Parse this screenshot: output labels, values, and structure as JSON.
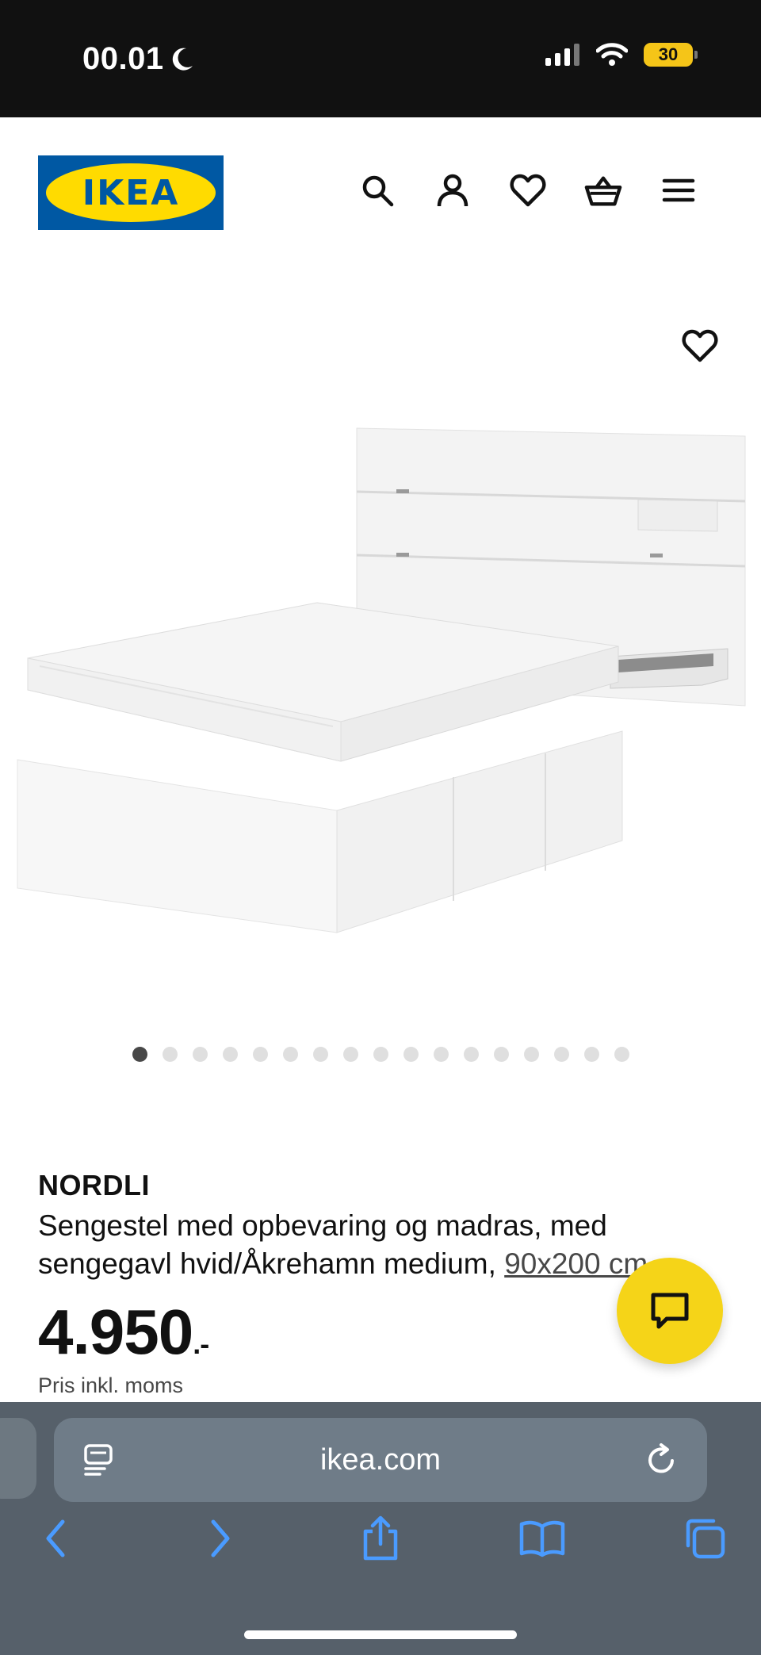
{
  "status_bar": {
    "time": "00.01",
    "battery": "30"
  },
  "header": {
    "logo_text": "IKEA",
    "icons": [
      "search-icon",
      "account-icon",
      "heart-icon",
      "basket-icon",
      "menu-icon"
    ]
  },
  "gallery": {
    "total_images": 17,
    "active_index": 0
  },
  "product": {
    "brand": "NORDLI",
    "description": "Sengestel med opbevaring og madras, med sengegavl hvid/Åkrehamn medium, ",
    "size": "90x200 cm",
    "price_main": "4.950",
    "price_suffix": ".-",
    "vat_note": "Pris inkl. moms"
  },
  "browser": {
    "url": "ikea.com"
  },
  "colors": {
    "ikea_blue": "#0058a3",
    "ikea_yellow": "#ffdb00",
    "chat_yellow": "#f5d418",
    "safari_blue": "#4a9bff"
  }
}
